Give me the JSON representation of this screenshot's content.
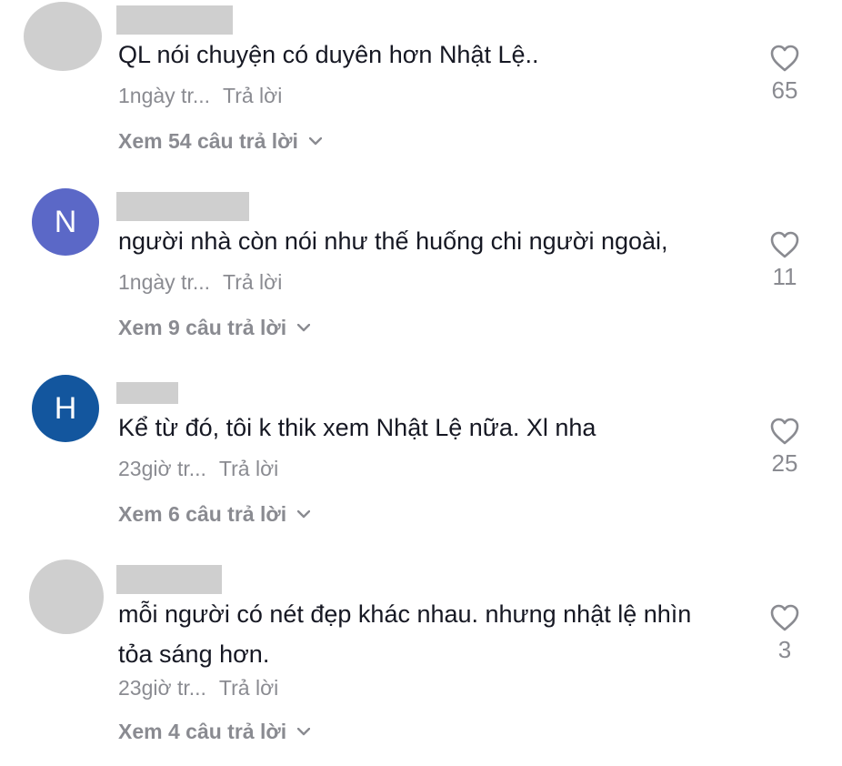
{
  "comments": [
    {
      "avatar_letter": "",
      "avatar_color": "#cfcfcf",
      "text": "QL nói chuyện có duyên hơn Nhật Lệ..",
      "time": "1ngày tr...",
      "reply_label": "Trả lời",
      "view_replies": "Xem 54 câu trả lời",
      "likes": "65"
    },
    {
      "avatar_letter": "N",
      "avatar_color": "#5b68c7",
      "text": "người nhà còn nói như thế huống chi người ngoài,",
      "time": "1ngày tr...",
      "reply_label": "Trả lời",
      "view_replies": "Xem 9 câu trả lời",
      "likes": "11"
    },
    {
      "avatar_letter": "H",
      "avatar_color": "#13569e",
      "text": "Kể từ đó, tôi k thik xem Nhật Lệ nữa. Xl nha",
      "time": "23giờ tr...",
      "reply_label": "Trả lời",
      "view_replies": "Xem 6 câu trả lời",
      "likes": "25"
    },
    {
      "avatar_letter": "",
      "avatar_color": "#cfcfcf",
      "text": "mỗi người có nét đẹp khác nhau. nhưng nhật lệ nhìn tỏa sáng hơn.",
      "time": "23giờ tr...",
      "reply_label": "Trả lời",
      "view_replies": "Xem 4 câu trả lời",
      "likes": "3"
    }
  ]
}
